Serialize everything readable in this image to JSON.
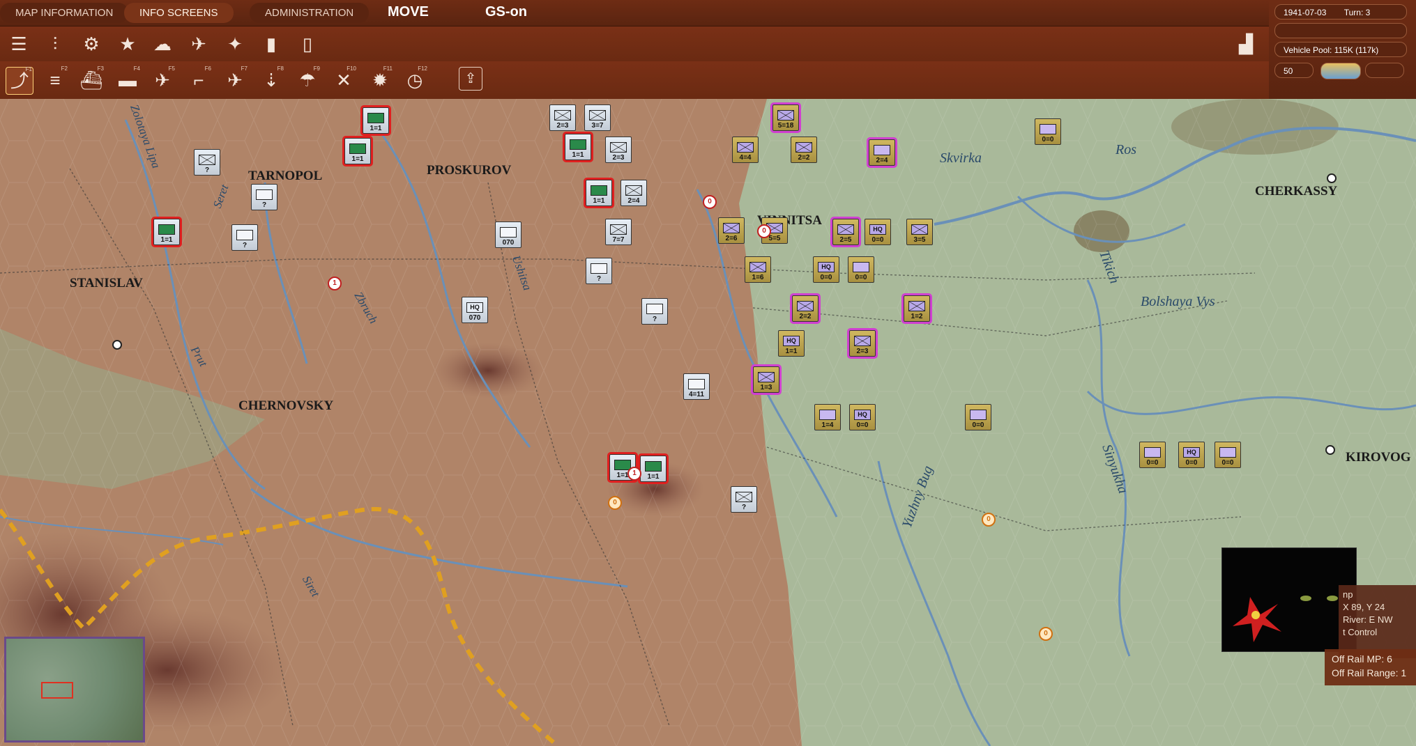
{
  "tabs": [
    "MAP INFORMATION",
    "INFO SCREENS",
    "ADMINISTRATION"
  ],
  "mode": "MOVE",
  "gs_mode": "GS-on",
  "status": {
    "date": "1941-07-03",
    "turn": "Turn: 3",
    "vehicle_pool": "Vehicle Pool: 115K (117k)",
    "value_box": "50"
  },
  "toolbar_row1": [
    "layers-icon",
    "sliders-icon",
    "gear-icon",
    "star-icon",
    "weather-icon",
    "air-recon-icon",
    "satellite-icon",
    "fuel-icon",
    "phone-icon"
  ],
  "toolbar_row2": [
    {
      "icon": "path-icon",
      "key": "F1"
    },
    {
      "icon": "rail-icon",
      "key": "F2"
    },
    {
      "icon": "ship-icon",
      "key": "F3"
    },
    {
      "icon": "landing-craft-icon",
      "key": "F4"
    },
    {
      "icon": "air-transfer-icon",
      "key": "F5"
    },
    {
      "icon": "airbase-icon",
      "key": "F6"
    },
    {
      "icon": "air-attack-icon",
      "key": "F7"
    },
    {
      "icon": "bomb-icon",
      "key": "F8"
    },
    {
      "icon": "paradrop-icon",
      "key": "F9"
    },
    {
      "icon": "interdiction-icon",
      "key": "F10"
    },
    {
      "icon": "explosion-icon",
      "key": "F11"
    },
    {
      "icon": "recon-icon",
      "key": "F12"
    },
    {
      "icon": "upload-icon",
      "key": ""
    }
  ],
  "cities": [
    "TARNOPOL",
    "PROSKUROV",
    "VINNITSA",
    "STANISLAV",
    "CHERNOVSKY",
    "CHERKASSY",
    "KIROVOG"
  ],
  "rivers": [
    "Zolotaya Lipa",
    "Seret",
    "Zbruch",
    "Ushitsa",
    "Prut",
    "Siret",
    "Skvirka",
    "Ros",
    "Tikich",
    "Bolshaya Vys",
    "Sinyukha",
    "Yuzhny Bug"
  ],
  "units": [
    {
      "side": "soviet",
      "type": "armor",
      "val": "1=1",
      "sel": "red"
    },
    {
      "side": "soviet",
      "type": "armor",
      "val": "1=1",
      "sel": "red"
    },
    {
      "side": "soviet",
      "type": "infantry",
      "val": "?",
      "sel": ""
    },
    {
      "side": "soviet",
      "type": "unknown",
      "val": "?",
      "sel": ""
    },
    {
      "side": "soviet",
      "type": "unknown",
      "val": "?",
      "sel": ""
    },
    {
      "side": "soviet",
      "type": "armor",
      "val": "1=1",
      "sel": "red"
    },
    {
      "side": "soviet",
      "type": "infantry",
      "val": "2=3",
      "sel": ""
    },
    {
      "side": "soviet",
      "type": "infantry",
      "val": "3=7",
      "sel": ""
    },
    {
      "side": "soviet",
      "type": "armor",
      "val": "1=1",
      "sel": "red"
    },
    {
      "side": "soviet",
      "type": "infantry",
      "val": "2=3",
      "sel": ""
    },
    {
      "side": "soviet",
      "type": "armor",
      "val": "1=1",
      "sel": "red"
    },
    {
      "side": "soviet",
      "type": "infantry",
      "val": "2=4",
      "sel": ""
    },
    {
      "side": "soviet",
      "type": "unknown",
      "val": "070",
      "sel": ""
    },
    {
      "side": "soviet",
      "type": "infantry",
      "val": "7=7",
      "sel": ""
    },
    {
      "side": "soviet",
      "type": "unknown",
      "val": "?",
      "sel": ""
    },
    {
      "side": "soviet",
      "type": "hq",
      "val": "070",
      "sel": ""
    },
    {
      "side": "soviet",
      "type": "unknown",
      "val": "?",
      "sel": ""
    },
    {
      "side": "soviet",
      "type": "armor",
      "val": "1=1",
      "sel": "red"
    },
    {
      "side": "soviet",
      "type": "armor",
      "val": "1=1",
      "sel": "red"
    },
    {
      "side": "soviet",
      "type": "unknown",
      "val": "4=11",
      "sel": ""
    },
    {
      "side": "soviet",
      "type": "infantry",
      "val": "?",
      "sel": ""
    },
    {
      "side": "german",
      "type": "infantry",
      "val": "5=18",
      "sel": "mag"
    },
    {
      "side": "german",
      "type": "infantry",
      "val": "4=4",
      "sel": ""
    },
    {
      "side": "german",
      "type": "infantry",
      "val": "2=2",
      "sel": ""
    },
    {
      "side": "german",
      "type": "unknown",
      "val": "2=4",
      "sel": "mag"
    },
    {
      "side": "german",
      "type": "infantry",
      "val": "2=6",
      "sel": ""
    },
    {
      "side": "german",
      "type": "infantry",
      "val": "5=5",
      "sel": ""
    },
    {
      "side": "german",
      "type": "infantry",
      "val": "2=5",
      "sel": "mag"
    },
    {
      "side": "german",
      "type": "hq",
      "val": "0=0",
      "sel": ""
    },
    {
      "side": "german",
      "type": "infantry",
      "val": "3=5",
      "sel": ""
    },
    {
      "side": "german",
      "type": "infantry",
      "val": "1=6",
      "sel": ""
    },
    {
      "side": "german",
      "type": "hq",
      "val": "0=0",
      "sel": ""
    },
    {
      "side": "german",
      "type": "unknown",
      "val": "0=0",
      "sel": ""
    },
    {
      "side": "german",
      "type": "infantry",
      "val": "2=2",
      "sel": "mag"
    },
    {
      "side": "german",
      "type": "infantry",
      "val": "1=2",
      "sel": "mag"
    },
    {
      "side": "german",
      "type": "hq",
      "val": "1=1",
      "sel": ""
    },
    {
      "side": "german",
      "type": "infantry",
      "val": "2=3",
      "sel": "mag"
    },
    {
      "side": "german",
      "type": "infantry",
      "val": "1=3",
      "sel": "mag"
    },
    {
      "side": "german",
      "type": "unknown",
      "val": "1=4",
      "sel": ""
    },
    {
      "side": "german",
      "type": "hq",
      "val": "0=0",
      "sel": ""
    },
    {
      "side": "german",
      "type": "unknown",
      "val": "0=0",
      "sel": ""
    },
    {
      "side": "german",
      "type": "unknown",
      "val": "0=0",
      "sel": ""
    },
    {
      "side": "german",
      "type": "hq",
      "val": "0=0",
      "sel": ""
    },
    {
      "side": "german",
      "type": "unknown",
      "val": "0=0",
      "sel": ""
    },
    {
      "side": "german",
      "type": "unknown",
      "val": "0=0",
      "sel": ""
    }
  ],
  "info_panel": {
    "line1": "np",
    "line2": "X 89, Y 24",
    "line3": "River: E NW",
    "line4": "t Control",
    "off_rail_mp": "Off Rail MP: 6",
    "off_rail_range": "Off Rail Range: 1"
  },
  "colors": {
    "topbar": "#6e2c14",
    "soviet_sel": "#e02020",
    "german_sel": "#d040d0",
    "front_line": "#e0a020"
  }
}
